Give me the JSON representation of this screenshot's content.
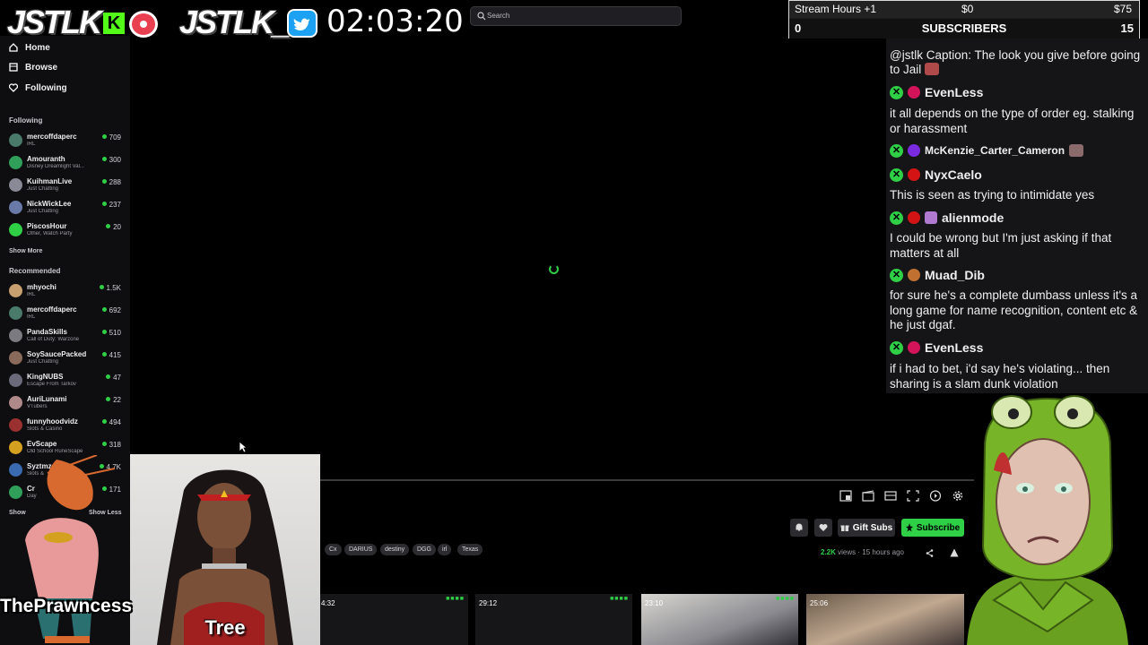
{
  "header": {
    "logo_left": "JSTLK",
    "kick_badge": "K",
    "logo_right": "JSTLK_",
    "timer": "02:03:20",
    "search_placeholder": "Search"
  },
  "stats": {
    "stream_hours": "Stream Hours +1",
    "amount": "$0",
    "goal": "$75",
    "sub_low": "0",
    "sub_label": "SUBSCRIBERS",
    "sub_goal": "15"
  },
  "sidebar": {
    "nav": [
      {
        "label": "Home",
        "icon": "home-icon"
      },
      {
        "label": "Browse",
        "icon": "browse-icon"
      },
      {
        "label": "Following",
        "icon": "heart-icon"
      }
    ],
    "following_title": "Following",
    "following": [
      {
        "name": "mercoffdaperc",
        "game": "IRL",
        "viewers": "709",
        "color": "#4a7a6a"
      },
      {
        "name": "Amouranth",
        "game": "Disney Dreamlight Val...",
        "viewers": "300",
        "color": "#2f9f5a"
      },
      {
        "name": "KuihmanLive",
        "game": "Just Chatting",
        "viewers": "288",
        "color": "#8a8a96"
      },
      {
        "name": "NickWickLee",
        "game": "Just Chatting",
        "viewers": "237",
        "color": "#6a7aa8"
      },
      {
        "name": "PiscosHour",
        "game": "Other, Watch Party",
        "viewers": "20",
        "color": "#2fcf46"
      }
    ],
    "show_more": "Show More",
    "recommended_title": "Recommended",
    "recommended": [
      {
        "name": "mhyochi",
        "game": "IRL",
        "viewers": "1.5K",
        "color": "#c8a070"
      },
      {
        "name": "mercoffdaperc",
        "game": "IRL",
        "viewers": "692",
        "color": "#4a7a6a"
      },
      {
        "name": "PandaSkills",
        "game": "Call of Duty: Warzone",
        "viewers": "510",
        "color": "#7a7a80"
      },
      {
        "name": "SoySaucePacked",
        "game": "Just Chatting",
        "viewers": "415",
        "color": "#8a6a5a"
      },
      {
        "name": "KingNUBS",
        "game": "Escape From Tarkov",
        "viewers": "47",
        "color": "#6a6a7a"
      },
      {
        "name": "AuriLunami",
        "game": "VTubers",
        "viewers": "22",
        "color": "#b08a8a"
      },
      {
        "name": "funnyhoodvidz",
        "game": "Slots & Casino",
        "viewers": "494",
        "color": "#9a3030"
      },
      {
        "name": "EvScape",
        "game": "Old School RuneScape",
        "viewers": "318",
        "color": "#d4a020"
      },
      {
        "name": "Syztmz",
        "game": "Slots &",
        "viewers": "4.7K",
        "color": "#3a6ab0"
      },
      {
        "name": "Cr",
        "game": "Day",
        "viewers": "171",
        "color": "#2f9f5a"
      }
    ],
    "show_less": "Show Less",
    "show_short": "Show"
  },
  "chat": {
    "top_text": "@jstlk Caption: The look you give before going to Jail",
    "messages": [
      {
        "user": "EvenLess",
        "dot": "#d4145a",
        "text": "it all depends on the type of order eg. stalking or harassment"
      },
      {
        "user": "McKenzie_Carter_Cameron",
        "dot": "#7a2be0",
        "text": ""
      },
      {
        "user": "NyxCaelo",
        "dot": "#d41414",
        "text": "This is seen as trying to intimidate yes"
      },
      {
        "user": "alienmode",
        "dot": "#d41414",
        "text": "I could be wrong but I'm just asking if that matters at all"
      },
      {
        "user": "Muad_Dib",
        "dot": "#c07030",
        "text": "for sure he's a complete dumbass unless it's a long game for name recognition, content etc & he just dgaf."
      },
      {
        "user": "EvenLess",
        "dot": "#d4145a",
        "text": "if i had to bet, i'd say he's violating... then sharing is a slam dunk violation"
      }
    ]
  },
  "player": {
    "gift_subs": "Gift Subs",
    "subscribe": "Subscribe",
    "tags": [
      "Cx",
      "DARIUS",
      "destiny",
      "DGG",
      "irl",
      "Texas"
    ],
    "views": "2.2K",
    "views_suffix": "views",
    "time_ago": "15 hours ago",
    "thumbs": [
      "4:32",
      "29:12",
      "23:10",
      "25:06"
    ]
  },
  "overlays": {
    "card_label": "Tree",
    "shrimp_label": "ThePrawncess"
  },
  "colors": {
    "accent": "#53fc18",
    "live": "#2fcf46",
    "panel": "#0e0e10"
  }
}
